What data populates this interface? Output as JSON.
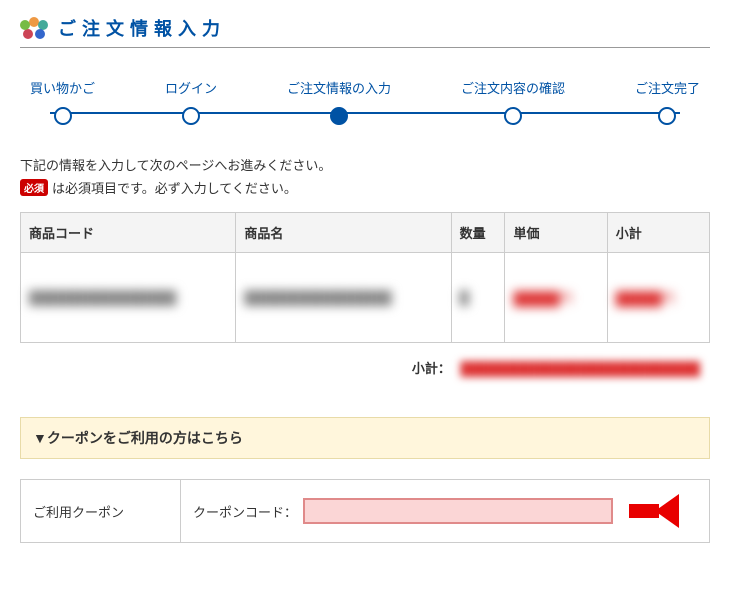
{
  "page_title": "ご注文情報入力",
  "steps": [
    "買い物かご",
    "ログイン",
    "ご注文情報の入力",
    "ご注文内容の確認",
    "ご注文完了"
  ],
  "current_step_index": 2,
  "instruction1": "下記の情報を入力して次のページへお進みください。",
  "required_badge": "必須",
  "instruction2": "は必須項目です。必ず入力してください。",
  "item_table": {
    "headers": {
      "code": "商品コード",
      "name": "商品名",
      "qty": "数量",
      "price": "単価",
      "subtotal": "小計"
    },
    "rows": [
      {
        "code": "████████████████",
        "name": "████████████████",
        "qty": "█",
        "price": "█████円",
        "subtotal": "█████円"
      }
    ]
  },
  "subtotal_label": "小計：",
  "subtotal_value": "██████████████████████████",
  "coupon_header": "▼クーポンをご利用の方はこちら",
  "coupon_section_label": "ご利用クーポン",
  "coupon_code_label": "クーポンコード：",
  "coupon_value": ""
}
